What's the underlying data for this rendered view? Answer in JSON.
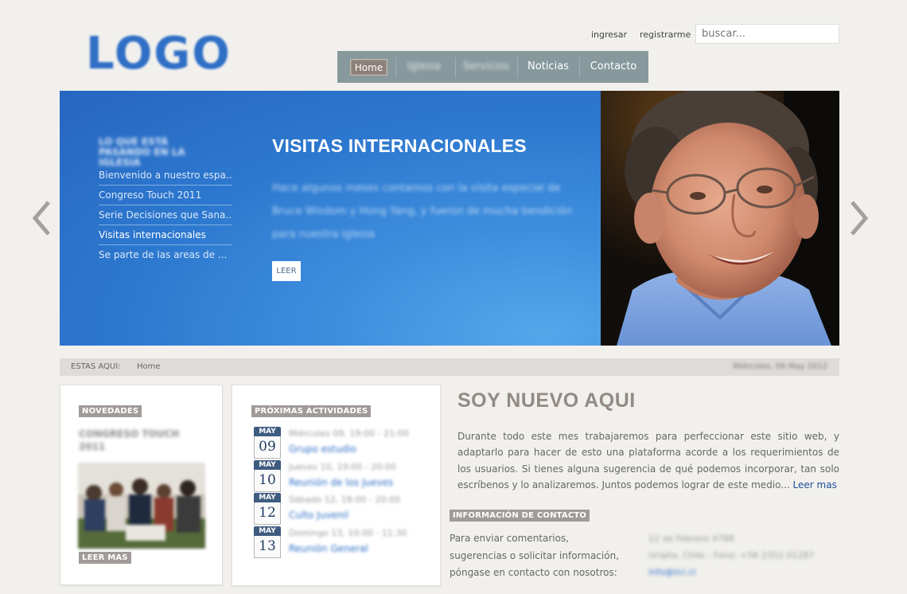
{
  "header": {
    "logo": "LOGO",
    "links": {
      "login": "ingresar",
      "register": "registrarme"
    },
    "search_placeholder": "buscar..."
  },
  "nav": {
    "items": [
      "Home",
      "Iglesia",
      "Servicios",
      "Noticias",
      "Contacto"
    ],
    "active": "Home"
  },
  "hero": {
    "side_title": "Lo que está pasando en la iglesia",
    "list": [
      "Bienvenido a nuestro espa...",
      "Congreso Touch 2011",
      "Serie Decisiones que Sana...",
      "Visitas internacionales",
      "Se parte de las areas de ..."
    ],
    "active_index": 3,
    "title": "VISITAS INTERNACIONALES",
    "description": "Hace algunos meses contamos con la visita especial de Bruce Wisdom y Hong Yang, y fueron de mucha bendición para nuestra iglesia",
    "button": "LEER"
  },
  "breadcrumb": {
    "label": "ESTAS AQUI:",
    "home": "Home",
    "date": "Miércoles, 09 May 2012"
  },
  "novedades": {
    "tag": "NOVEDADES",
    "title": "CONGRESO TOUCH 2011",
    "more": "LEER MAS"
  },
  "actividades": {
    "tag": "PRÓXIMAS ACTIVIDADES",
    "items": [
      {
        "month": "MAY",
        "day": "09",
        "when": "Miércoles 09, 19:00 - 21:00",
        "name": "Grupo estudio"
      },
      {
        "month": "MAY",
        "day": "10",
        "when": "Jueves 10, 19:00 - 20:00",
        "name": "Reunión de los Jueves"
      },
      {
        "month": "MAY",
        "day": "12",
        "when": "Sábado 12, 18:00 - 20:00",
        "name": "Culto Juvenil"
      },
      {
        "month": "MAY",
        "day": "13",
        "when": "Domingo 13, 10:00 - 11:30",
        "name": "Reunión General"
      }
    ]
  },
  "soy_nuevo": {
    "title": "SOY NUEVO AQUI",
    "text": "Durante todo este mes trabajaremos para perfeccionar este sitio web, y adaptarlo para hacer de esto una plataforma acorde a los requerimientos de los usuarios. Si tienes alguna sugerencia de qué podemos incorporar, tan solo escríbenos y lo analizaremos. Juntos podemos lograr de este medio...",
    "link": "Leer mas"
  },
  "contacto": {
    "tag": "INFORMACIÓN DE CONTACTO",
    "text": "Para enviar comentarios, sugerencias o solicitar información, póngase en contacto con nosotros:",
    "address": "12 de Febrero 4788",
    "phone": "Urlaña, Chile - Fono: +56 2352 01287",
    "email": "info@iici.cl"
  },
  "colors": {
    "background": "#f1f0ed",
    "nav": "#87999d",
    "hero_blue": "#2d78cf",
    "tag_gray": "#a09b99",
    "link_blue": "#1f4f9c"
  }
}
